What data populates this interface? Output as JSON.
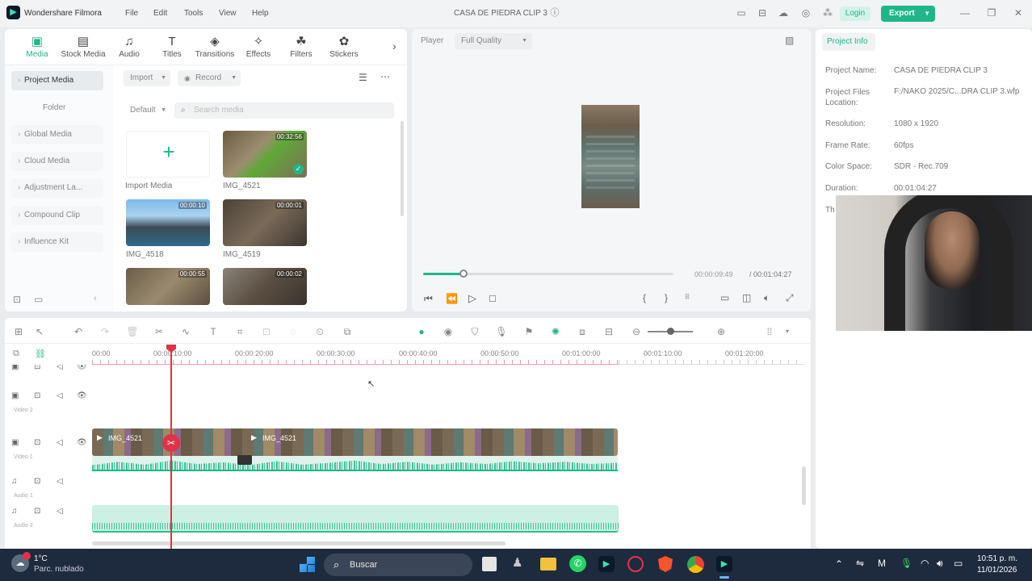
{
  "app": {
    "name": "Wondershare Filmora",
    "project_title": "CASA DE PIEDRA CLIP 3",
    "menu": [
      "File",
      "Edit",
      "Tools",
      "View",
      "Help"
    ],
    "login": "Login",
    "export": "Export"
  },
  "media_tabs": [
    {
      "label": "Media",
      "icon": "media-icon",
      "active": true
    },
    {
      "label": "Stock Media",
      "icon": "stock-media-icon"
    },
    {
      "label": "Audio",
      "icon": "music-note-icon"
    },
    {
      "label": "Titles",
      "icon": "text-icon"
    },
    {
      "label": "Transitions",
      "icon": "transition-icon"
    },
    {
      "label": "Effects",
      "icon": "effects-icon"
    },
    {
      "label": "Filters",
      "icon": "filters-icon"
    },
    {
      "label": "Stickers",
      "icon": "sticker-icon"
    }
  ],
  "sidebar": {
    "items": [
      "Project Media",
      "Folder",
      "Global Media",
      "Cloud Media",
      "Adjustment La...",
      "Compound Clip",
      "Influence Kit"
    ]
  },
  "media_toolbar": {
    "import": "Import",
    "record": "Record",
    "sort": "Default",
    "search_placeholder": "Search media"
  },
  "media_items": [
    {
      "label": "Import Media"
    },
    {
      "label": "IMG_4521",
      "duration": "00:32:56"
    },
    {
      "label": "IMG_4518",
      "duration": "00:00:10"
    },
    {
      "label": "IMG_4519",
      "duration": "00:00:01"
    },
    {
      "label": "",
      "duration": "00:00:55"
    },
    {
      "label": "",
      "duration": "00:00:02"
    }
  ],
  "player": {
    "label": "Player",
    "quality": "Full Quality",
    "current_time": "00:00:09:49",
    "total_time": "/ 00:01:04:27",
    "progress": 0.16
  },
  "project_info": {
    "tab": "Project Info",
    "fields": [
      {
        "label": "Project Name:",
        "value": "CASA DE PIEDRA CLIP 3"
      },
      {
        "label": "Project Files Location:",
        "value": "F:/NAKO 2025/C...DRA CLIP 3.wfp"
      },
      {
        "label": "Resolution:",
        "value": "1080 x 1920"
      },
      {
        "label": "Frame Rate:",
        "value": "60fps"
      },
      {
        "label": "Color Space:",
        "value": "SDR - Rec.709"
      },
      {
        "label": "Duration:",
        "value": "00:01:04:27"
      }
    ],
    "partial_label": "Th"
  },
  "timeline": {
    "ruler": [
      "00:00",
      "00:00:10:00",
      "00:00:20:00",
      "00:00:30:00",
      "00:00:40:00",
      "00:00:50:00",
      "00:01:00:00",
      "00:01:10:00",
      "00:01:20:00"
    ],
    "tracks": {
      "video2": "Video 2",
      "video1": "Video 1",
      "audio1": "Audio 1",
      "audio2": "Audio 2"
    },
    "clip1_label": "IMG_4521",
    "clip2_label": "IMG_4521",
    "playhead_time": "00:00:10:00"
  },
  "taskbar": {
    "weather_temp": "1°C",
    "weather_desc": "Parc. nublado",
    "search": "Buscar",
    "time": "10:51 p. m.",
    "date": "11/01/2026"
  },
  "colors": {
    "accent": "#1fb68a",
    "playhead": "#e0334a",
    "taskbar": "#1e2a3e"
  }
}
